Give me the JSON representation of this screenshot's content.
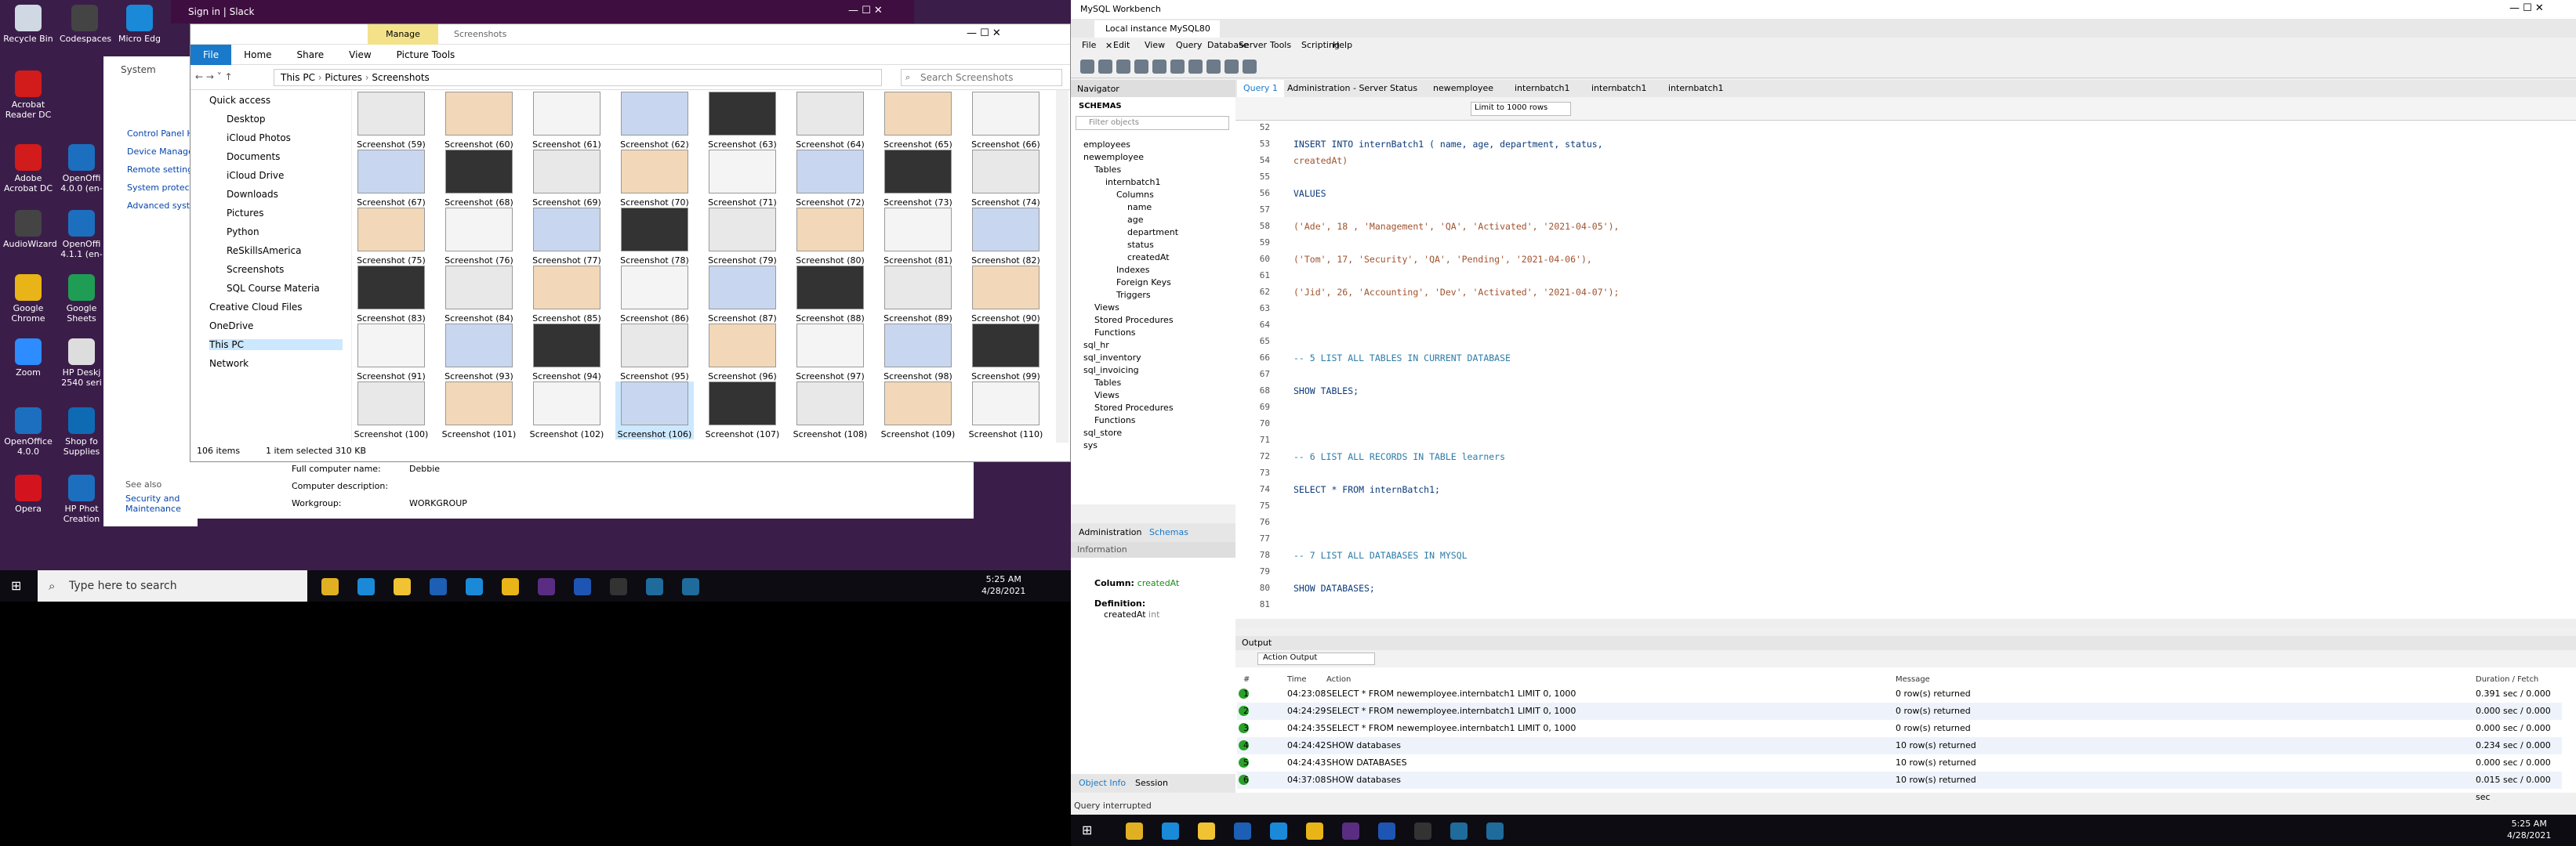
{
  "slack": {
    "title": "Sign in | Slack"
  },
  "desktop": {
    "icons": [
      {
        "label": "Recycle Bin",
        "color": "#cfd8e3"
      },
      {
        "label": "Codespaces",
        "color": "#444"
      },
      {
        "label": "Micro Edg",
        "color": "#1a8ad8"
      },
      {
        "label": "Acrobat Reader DC",
        "color": "#d21b1b"
      },
      {
        "label": "Adobe Acrobat DC",
        "color": "#d21b1b"
      },
      {
        "label": "OpenOffi 4.0.0 (en-",
        "color": "#1c6fbf"
      },
      {
        "label": "AudioWizard",
        "color": "#444"
      },
      {
        "label": "OpenOffi 4.1.1 (en-",
        "color": "#1c6fbf"
      },
      {
        "label": "Google Chrome",
        "color": "#e8b417"
      },
      {
        "label": "Google Sheets",
        "color": "#1f9d55"
      },
      {
        "label": "Zoom",
        "color": "#2d8cff"
      },
      {
        "label": "HP Deskj 2540 seri",
        "color": "#ddd"
      },
      {
        "label": "OpenOffice 4.0.0",
        "color": "#1c6fbf"
      },
      {
        "label": "Shop fo Supplies",
        "color": "#0f6ab4"
      },
      {
        "label": "Opera",
        "color": "#d3141e"
      },
      {
        "label": "HP Phot Creation",
        "color": "#1c6fbf"
      }
    ]
  },
  "system": {
    "title": "System",
    "items": [
      "Control Panel H",
      "Device Manage",
      "Remote setting",
      "System protecti",
      "Advanced syst"
    ],
    "see_also": "See also",
    "sec": "Security and Maintenance",
    "fields": [
      {
        "k": "Full computer name:",
        "v": "Debbie"
      },
      {
        "k": "Computer description:",
        "v": ""
      },
      {
        "k": "Workgroup:",
        "v": "WORKGROUP"
      }
    ]
  },
  "explorer": {
    "title_manage": "Manage",
    "title_folder": "Screenshots",
    "tabs": [
      "File",
      "Home",
      "Share",
      "View",
      "Picture Tools"
    ],
    "breadcrumb": [
      "This PC",
      "Pictures",
      "Screenshots"
    ],
    "search_placeholder": "Search Screenshots",
    "nav": [
      "Quick access",
      "Desktop",
      "iCloud Photos",
      "Documents",
      "iCloud Drive",
      "Downloads",
      "Pictures",
      "Python",
      "ReSkillsAmerica",
      "Screenshots",
      "SQL Course Materia",
      "Creative Cloud Files",
      "OneDrive",
      "This PC",
      "Network"
    ],
    "thumbs": [
      "Screenshot (59)",
      "Screenshot (60)",
      "Screenshot (61)",
      "Screenshot (62)",
      "Screenshot (63)",
      "Screenshot (64)",
      "Screenshot (65)",
      "Screenshot (66)",
      "Screenshot (67)",
      "Screenshot (68)",
      "Screenshot (69)",
      "Screenshot (70)",
      "Screenshot (71)",
      "Screenshot (72)",
      "Screenshot (73)",
      "Screenshot (74)",
      "Screenshot (75)",
      "Screenshot (76)",
      "Screenshot (77)",
      "Screenshot (78)",
      "Screenshot (79)",
      "Screenshot (80)",
      "Screenshot (81)",
      "Screenshot (82)",
      "Screenshot (83)",
      "Screenshot (84)",
      "Screenshot (85)",
      "Screenshot (86)",
      "Screenshot (87)",
      "Screenshot (88)",
      "Screenshot (89)",
      "Screenshot (90)",
      "Screenshot (91)",
      "Screenshot (93)",
      "Screenshot (94)",
      "Screenshot (95)",
      "Screenshot (96)",
      "Screenshot (97)",
      "Screenshot (98)",
      "Screenshot (99)",
      "Screenshot (100)",
      "Screenshot (101)",
      "Screenshot (102)",
      "Screenshot (106)",
      "Screenshot (107)",
      "Screenshot (108)",
      "Screenshot (109)",
      "Screenshot (110)"
    ],
    "status_items": "106 items",
    "status_sel": "1 item selected  310 KB"
  },
  "taskbar_left": {
    "search": "Type here to search",
    "time": "5:25 AM",
    "date": "4/28/2021"
  },
  "taskbar_right": {
    "time": "5:25 AM",
    "date": "4/28/2021"
  },
  "wb": {
    "title": "MySQL Workbench",
    "conn_tab": "Local instance MySQL80",
    "menu": [
      "File",
      "Edit",
      "View",
      "Query",
      "Database",
      "Server",
      "Tools",
      "Scripting",
      "Help"
    ],
    "navigator": "Navigator",
    "schemas": "SCHEMAS",
    "filter": "Filter objects",
    "qtabs": [
      "Query 1",
      "Administration - Server Status",
      "newemployee",
      "internbatch1",
      "internbatch1",
      "internbatch1"
    ],
    "limit": "Limit to 1000 rows",
    "tree": [
      {
        "t": "employees",
        "d": 0
      },
      {
        "t": "newemployee",
        "d": 0
      },
      {
        "t": "Tables",
        "d": 1
      },
      {
        "t": "internbatch1",
        "d": 2
      },
      {
        "t": "Columns",
        "d": 3
      },
      {
        "t": "name",
        "d": 4
      },
      {
        "t": "age",
        "d": 4
      },
      {
        "t": "department",
        "d": 4
      },
      {
        "t": "status",
        "d": 4
      },
      {
        "t": "createdAt",
        "d": 4
      },
      {
        "t": "Indexes",
        "d": 3
      },
      {
        "t": "Foreign Keys",
        "d": 3
      },
      {
        "t": "Triggers",
        "d": 3
      },
      {
        "t": "Views",
        "d": 1
      },
      {
        "t": "Stored Procedures",
        "d": 1
      },
      {
        "t": "Functions",
        "d": 1
      },
      {
        "t": "sql_hr",
        "d": 0
      },
      {
        "t": "sql_inventory",
        "d": 0
      },
      {
        "t": "sql_invoicing",
        "d": 0
      },
      {
        "t": "Tables",
        "d": 1
      },
      {
        "t": "Views",
        "d": 1
      },
      {
        "t": "Stored Procedures",
        "d": 1
      },
      {
        "t": "Functions",
        "d": 1
      },
      {
        "t": "sql_store",
        "d": 0
      },
      {
        "t": "sys",
        "d": 0
      }
    ],
    "sidetabs": [
      "Administration",
      "Schemas"
    ],
    "info": "Information",
    "col_label": "Column:",
    "col_name": "createdAt",
    "def_label": "Definition:",
    "def_col": "createdAt",
    "def_type": "int",
    "bottom_tabs": [
      "Object Info",
      "Session"
    ],
    "lines": [
      {
        "n": "52",
        "c": ""
      },
      {
        "n": "53",
        "c": "INSERT INTO internBatch1 ( name, age, department, status,"
      },
      {
        "n": "54",
        "c": "createdAt)"
      },
      {
        "n": "55",
        "c": ""
      },
      {
        "n": "56",
        "c": "VALUES"
      },
      {
        "n": "57",
        "c": ""
      },
      {
        "n": "58",
        "c": "('Ade', 18 , 'Management', 'QA', 'Activated', '2021-04-05'),"
      },
      {
        "n": "59",
        "c": ""
      },
      {
        "n": "60",
        "c": "('Tom', 17, 'Security', 'QA', 'Pending', '2021-04-06'),"
      },
      {
        "n": "61",
        "c": ""
      },
      {
        "n": "62",
        "c": "('Jid', 26, 'Accounting', 'Dev', 'Activated', '2021-04-07');"
      },
      {
        "n": "63",
        "c": ""
      },
      {
        "n": "64",
        "c": ""
      },
      {
        "n": "65",
        "c": ""
      },
      {
        "n": "66",
        "c": "-- 5 LIST ALL TABLES IN CURRENT DATABASE"
      },
      {
        "n": "67",
        "c": ""
      },
      {
        "n": "68",
        "c": "SHOW TABLES;"
      },
      {
        "n": "69",
        "c": ""
      },
      {
        "n": "70",
        "c": ""
      },
      {
        "n": "71",
        "c": ""
      },
      {
        "n": "72",
        "c": "-- 6 LIST ALL RECORDS IN TABLE learners"
      },
      {
        "n": "73",
        "c": ""
      },
      {
        "n": "74",
        "c": "SELECT * FROM internBatch1;"
      },
      {
        "n": "75",
        "c": ""
      },
      {
        "n": "76",
        "c": ""
      },
      {
        "n": "77",
        "c": ""
      },
      {
        "n": "78",
        "c": "-- 7 LIST ALL DATABASES IN MYSQL"
      },
      {
        "n": "79",
        "c": ""
      },
      {
        "n": "80",
        "c": "SHOW DATABASES;"
      },
      {
        "n": "81",
        "c": ""
      }
    ],
    "output": "Output",
    "action_output": "Action Output",
    "headers": [
      "#",
      "Time",
      "Action",
      "Message",
      "Duration / Fetch"
    ],
    "rows": [
      {
        "n": "1",
        "t": "04:23:08",
        "a": "SELECT * FROM newemployee.internbatch1 LIMIT 0, 1000",
        "m": "0 row(s) returned",
        "d": "0.391 sec / 0.000 sec"
      },
      {
        "n": "2",
        "t": "04:24:29",
        "a": "SELECT * FROM newemployee.internbatch1 LIMIT 0, 1000",
        "m": "0 row(s) returned",
        "d": "0.000 sec / 0.000 sec"
      },
      {
        "n": "3",
        "t": "04:24:35",
        "a": "SELECT * FROM newemployee.internbatch1 LIMIT 0, 1000",
        "m": "0 row(s) returned",
        "d": "0.000 sec / 0.000 sec"
      },
      {
        "n": "4",
        "t": "04:24:42",
        "a": "SHOW databases",
        "m": "10 row(s) returned",
        "d": "0.234 sec / 0.000 sec"
      },
      {
        "n": "5",
        "t": "04:24:43",
        "a": "SHOW DATABASES",
        "m": "10 row(s) returned",
        "d": "0.000 sec / 0.000 sec"
      },
      {
        "n": "6",
        "t": "04:37:08",
        "a": "SHOW databases",
        "m": "10 row(s) returned",
        "d": "0.015 sec / 0.000 sec"
      }
    ],
    "status": "Query interrupted"
  }
}
